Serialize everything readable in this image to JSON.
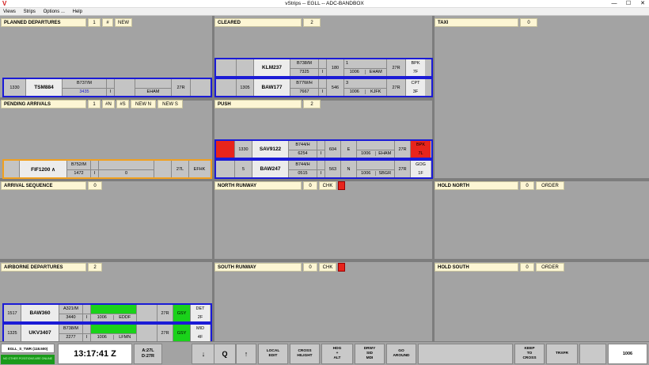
{
  "window": {
    "title": "vStrips -- EGLL -- ADC-BANDBOX",
    "logo": "V",
    "minimize": "—",
    "maximize": "☐",
    "close": "✕"
  },
  "menu": [
    "Views",
    "Strips",
    "Options ...",
    "Help"
  ],
  "bays": {
    "planned_departures": {
      "title": "PLANNED DEPARTURES",
      "count": "1",
      "hash": "#",
      "new": "NEW"
    },
    "cleared": {
      "title": "CLEARED",
      "count": "2"
    },
    "taxi": {
      "title": "TAXI",
      "count": "0"
    },
    "pending_arrivals": {
      "title": "PENDING ARRIVALS",
      "count": "1",
      "hash_n": "#N",
      "hash_s": "#S",
      "new_n": "NEW N",
      "new_s": "NEW S"
    },
    "push": {
      "title": "PUSH",
      "count": "2"
    },
    "arrival_sequence": {
      "title": "ARRIVAL SEQUENCE",
      "count": "0"
    },
    "north_runway": {
      "title": "NORTH RUNWAY",
      "count": "0",
      "chk": "CHK"
    },
    "hold_north": {
      "title": "HOLD NORTH",
      "count": "0",
      "order": "ORDER"
    },
    "airborne_departures": {
      "title": "AIRBORNE DEPARTURES",
      "count": "2"
    },
    "south_runway": {
      "title": "SOUTH RUNWAY",
      "count": "0",
      "chk": "CHK"
    },
    "hold_south": {
      "title": "HOLD SOUTH",
      "count": "0",
      "order": "ORDER"
    }
  },
  "strips": {
    "tsm884": {
      "time": "1330",
      "callsign": "TSM884",
      "type": "B737/M",
      "squawk": "3435",
      "i": "I",
      "dest": "EHAM",
      "rwy": "27R"
    },
    "klm237": {
      "callsign": "KLM237",
      "type": "B738/M",
      "squawk": "7325",
      "i": "I",
      "fl": "180",
      "one": "1",
      "qnh": "1006",
      "dest": "EHAM",
      "rwy": "27R",
      "stand": "BPK",
      "stand2": "7F"
    },
    "baw177": {
      "time": "1305",
      "callsign": "BAW177",
      "type": "B77W/H",
      "squawk": "7667",
      "i": "I",
      "fl": "546",
      "three": "3",
      "qnh": "1006",
      "dest": "KJFK",
      "rwy": "27R",
      "stand": "CPT",
      "stand2": "3F"
    },
    "fif1200": {
      "callsign": "FIF1200 ∧",
      "type": "B752/M",
      "num": "1472",
      "i": "I",
      "zero": "0",
      "rwy": "27L",
      "dest": "EFHK"
    },
    "sav9122": {
      "time": "1330",
      "callsign": "SAV9122",
      "type": "B744/H",
      "squawk": "6254",
      "i": "I",
      "fl": "604",
      "dir": "E",
      "qnh": "1006",
      "dest": "EHAM",
      "rwy": "27R",
      "stand": "BPK",
      "stand2": "7L"
    },
    "baw247": {
      "time": "5",
      "callsign": "BAW247",
      "type": "B744/H",
      "squawk": "0515",
      "i": "I",
      "fl": "563",
      "dir": "N",
      "qnh": "1006",
      "dest": "SBGR",
      "rwy": "27R",
      "stand": "GOG",
      "stand2": "1F"
    },
    "baw360": {
      "time": "1517",
      "callsign": "BAW360",
      "type": "A321/M",
      "squawk": "3440",
      "i": "I",
      "qnh": "1006",
      "dest": "EDDF",
      "rwy": "27R",
      "gsy": "GSY",
      "stand": "DET",
      "stand2": "2F"
    },
    "ukv3407": {
      "time": "1325",
      "callsign": "UKV3407",
      "type": "B738/M",
      "squawk": "2277",
      "i": "I",
      "qnh": "1006",
      "dest": "LFMN",
      "rwy": "27R",
      "gsy": "GSY",
      "stand": "MID",
      "stand2": "4F"
    }
  },
  "toolbar": {
    "position": "EGLL_S_TWR (118.500)",
    "status": "NO OTHER POSITIONS ARE ONLINE",
    "clock": "13:17:41 Z",
    "arr_rwy": "A:27L",
    "dep_rwy": "D:27R",
    "down": "↓",
    "q": "Q",
    "up": "↑",
    "local_edit_1": "LOCAL",
    "local_edit_2": "EDIT",
    "cross_1": "CROSS",
    "cross_2": "HILIGHT",
    "hdg_1": "HDG",
    "hdg_2": "+",
    "hdg_3": "ALT",
    "drwy_1": "DRWY",
    "drwy_2": "SID",
    "drwy_3": "MDI",
    "go_1": "GO",
    "go_2": "AROUND",
    "keep_1": "KEEP",
    "keep_2": "TO",
    "keep_3": "CROSS",
    "trxfr": "TRXFR",
    "qnh": "1006"
  },
  "colors": {
    "strip_border": "#1b1bd6",
    "arrival_border": "#f0a020",
    "header_bg": "#fdf6d4",
    "alert": "#e8241c",
    "green": "#1ad21a"
  }
}
